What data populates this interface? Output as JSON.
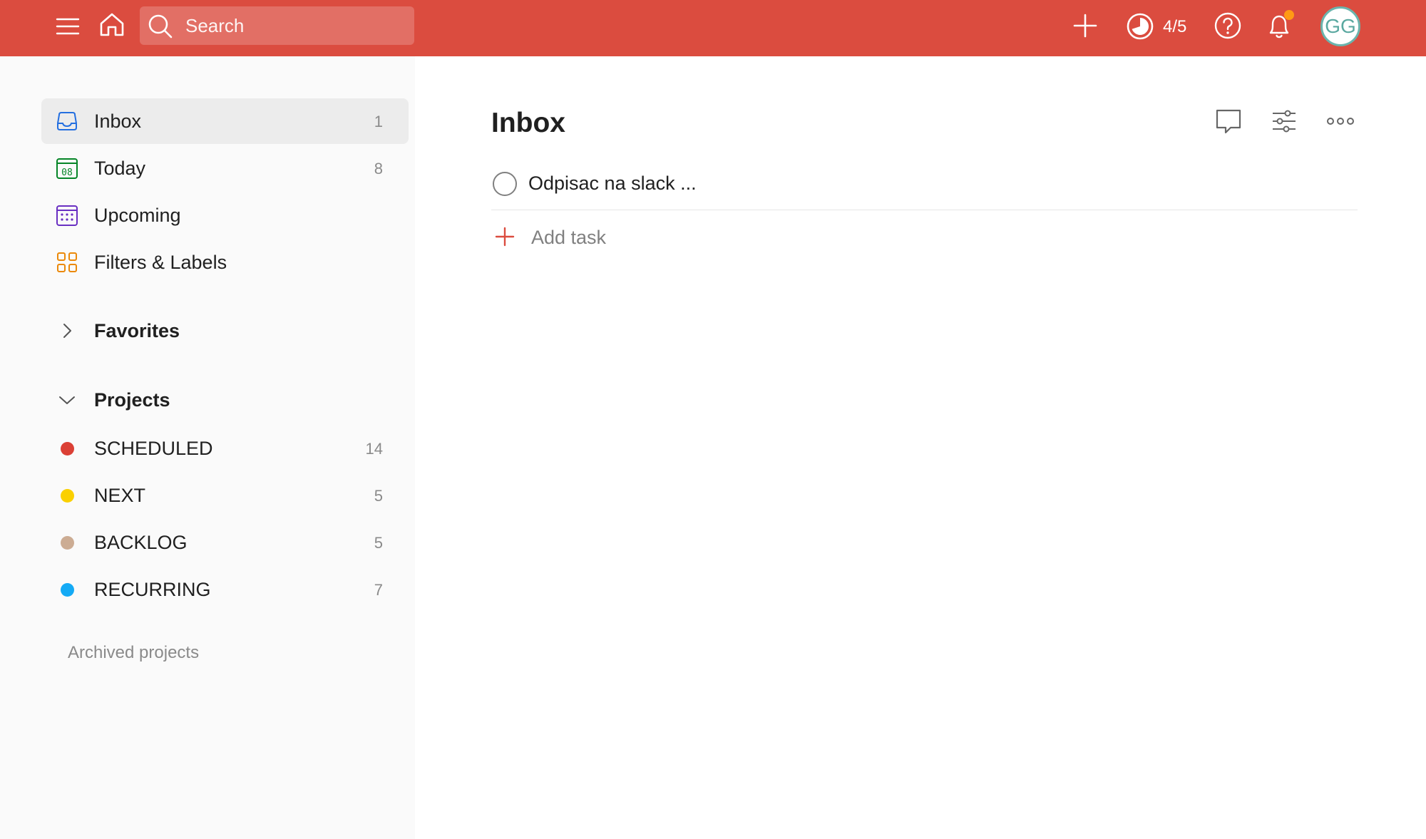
{
  "topbar": {
    "search_placeholder": "Search",
    "karma_progress": "4/5",
    "avatar_initials": "GG"
  },
  "sidebar": {
    "nav": [
      {
        "label": "Inbox",
        "count": "1",
        "icon": "inbox-icon"
      },
      {
        "label": "Today",
        "count": "8",
        "icon": "calendar-today-icon",
        "icon_text": "08"
      },
      {
        "label": "Upcoming",
        "count": "",
        "icon": "calendar-upcoming-icon"
      },
      {
        "label": "Filters & Labels",
        "count": "",
        "icon": "filters-labels-icon"
      }
    ],
    "favorites_label": "Favorites",
    "projects_label": "Projects",
    "projects": [
      {
        "label": "SCHEDULED",
        "count": "14",
        "color": "#db4035"
      },
      {
        "label": "NEXT",
        "count": "5",
        "color": "#fad000"
      },
      {
        "label": "BACKLOG",
        "count": "5",
        "color": "#ccac93"
      },
      {
        "label": "RECURRING",
        "count": "7",
        "color": "#14aaf5"
      }
    ],
    "archived_label": "Archived projects"
  },
  "main": {
    "title": "Inbox",
    "tasks": [
      {
        "title": "Odpisac na slack ..."
      }
    ],
    "add_task_label": "Add task"
  },
  "colors": {
    "brand": "#db4c3f",
    "inbox_icon": "#246fe0",
    "today_icon": "#058527",
    "upcoming_icon": "#692fc2",
    "filters_icon": "#eb8909",
    "notification_dot": "#ff9a14"
  }
}
